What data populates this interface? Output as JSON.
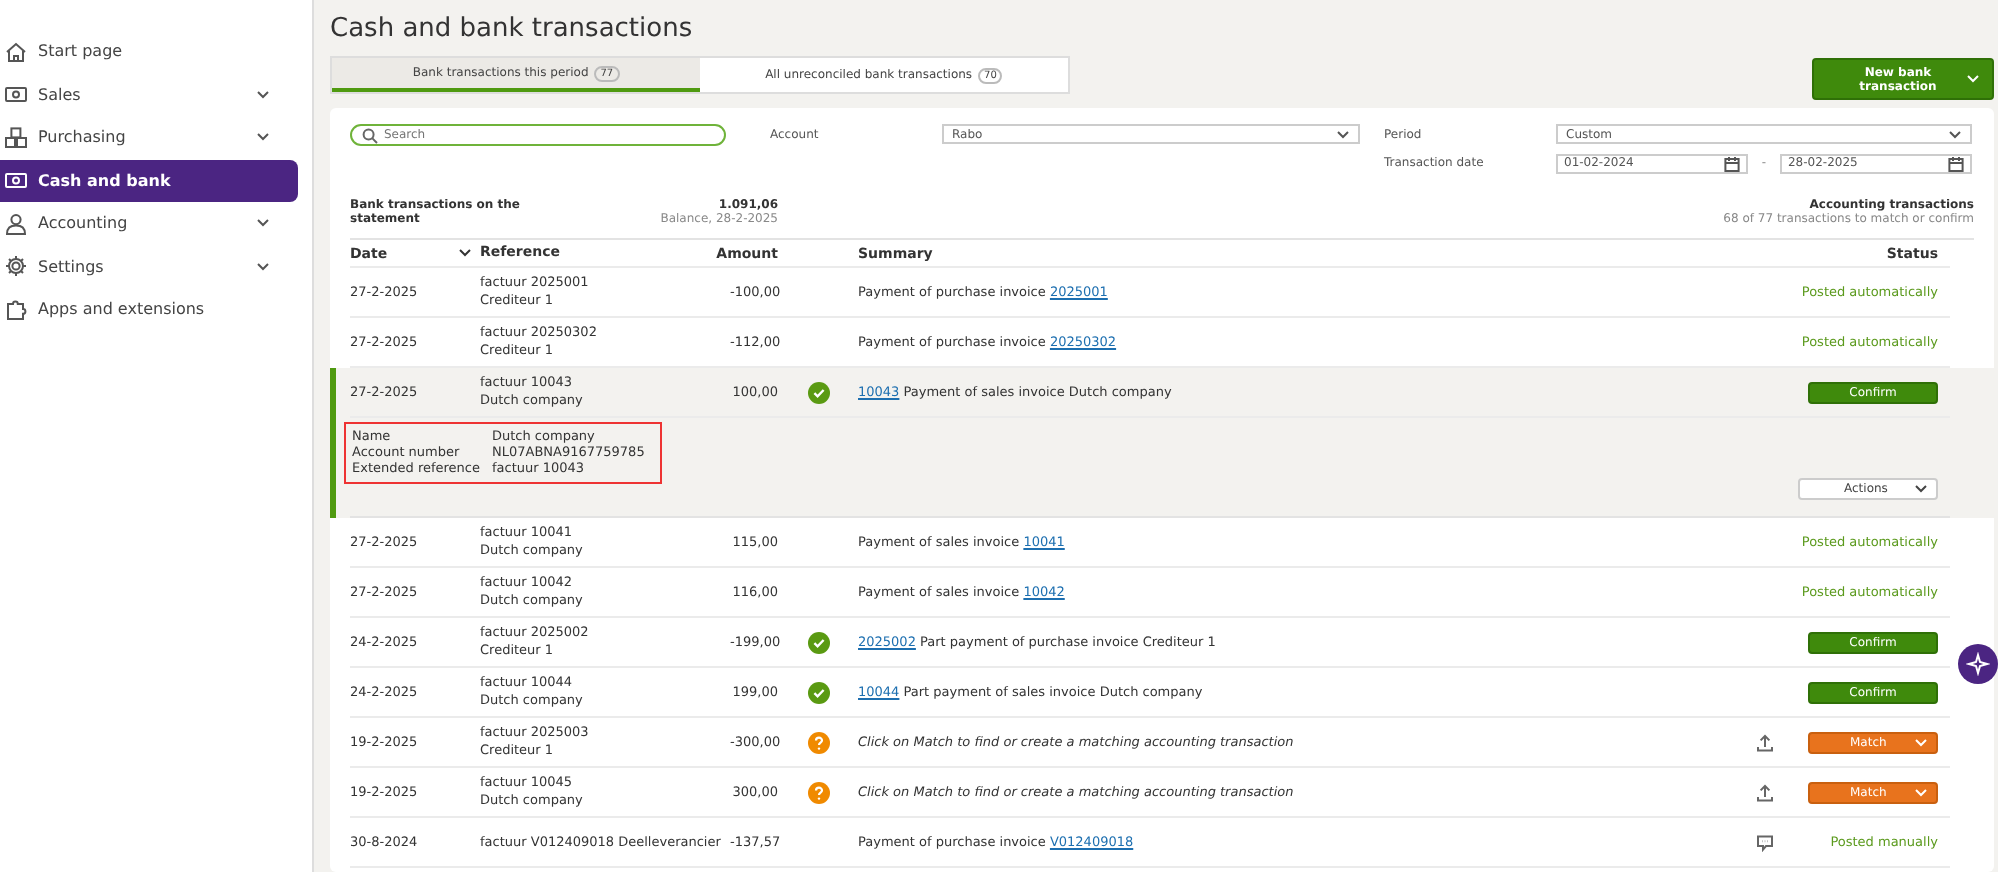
{
  "sidebar": {
    "items": [
      {
        "label": "Start page",
        "chevron": false,
        "selected": false
      },
      {
        "label": "Sales",
        "chevron": true,
        "selected": false
      },
      {
        "label": "Purchasing",
        "chevron": true,
        "selected": false
      },
      {
        "label": "Cash and bank",
        "chevron": false,
        "selected": true
      },
      {
        "label": "Accounting",
        "chevron": true,
        "selected": false
      },
      {
        "label": "Settings",
        "chevron": true,
        "selected": false
      },
      {
        "label": "Apps and extensions",
        "chevron": false,
        "selected": false
      }
    ]
  },
  "page": {
    "title": "Cash and bank transactions"
  },
  "tabs": [
    {
      "label": "Bank transactions this period",
      "count": "77",
      "selected": true
    },
    {
      "label": "All unreconciled bank transactions",
      "count": "70",
      "selected": false
    }
  ],
  "new_button": {
    "label": "New bank transaction"
  },
  "filters": {
    "search": {
      "placeholder": "Search"
    },
    "account": {
      "label": "Account",
      "value": "Rabo"
    },
    "period": {
      "label": "Period",
      "value": "Custom"
    },
    "transaction_date": {
      "label": "Transaction date",
      "from": "01-02-2024",
      "separator": "-",
      "to": "28-02-2025"
    }
  },
  "statement": {
    "label": "Bank transactions on the statement",
    "amount": "1.091,06",
    "balance": "Balance, 28-2-2025"
  },
  "accounting": {
    "label": "Accounting transactions",
    "note": "68 of 77 transactions to match or confirm"
  },
  "table": {
    "columns": [
      "Date",
      "Reference",
      "Amount",
      "Summary",
      "Status"
    ],
    "rows": [
      {
        "kind": "posted",
        "date": "27-2-2025",
        "reference": [
          "factuur 2025001",
          "Crediteur 1"
        ],
        "amount": "-100,00",
        "summary": {
          "kind": "link_last",
          "text": "Payment of purchase invoice",
          "link": "2025001"
        },
        "has_note": false,
        "status": "Posted automatically",
        "expanded": false
      },
      {
        "kind": "posted",
        "date": "27-2-2025",
        "reference": [
          "factuur 20250302",
          "Crediteur 1"
        ],
        "amount": "-112,00",
        "summary": {
          "kind": "link_last",
          "text": "Payment of purchase invoice",
          "link": "20250302"
        },
        "has_note": false,
        "status": "Posted automatically",
        "expanded": false
      },
      {
        "kind": "confirm",
        "date": "27-2-2025",
        "reference": [
          "factuur 10043",
          "Dutch company"
        ],
        "amount": "100,00",
        "summary": {
          "kind": "link_first",
          "text": "Payment of sales invoice Dutch company",
          "link": "10043"
        },
        "has_note": false,
        "status": "Confirm",
        "expanded": true,
        "details": [
          {
            "label": "Name",
            "value": "Dutch company"
          },
          {
            "label": "Account number",
            "value": "NL07ABNA9167759785"
          },
          {
            "label": "Extended reference",
            "value": "factuur 10043"
          }
        ],
        "actions_label": "Actions"
      },
      {
        "kind": "posted",
        "date": "27-2-2025",
        "reference": [
          "factuur 10041",
          "Dutch company"
        ],
        "amount": "115,00",
        "summary": {
          "kind": "link_last",
          "text": "Payment of sales invoice",
          "link": "10041"
        },
        "has_note": false,
        "status": "Posted automatically",
        "expanded": false
      },
      {
        "kind": "posted",
        "date": "27-2-2025",
        "reference": [
          "factuur 10042",
          "Dutch company"
        ],
        "amount": "116,00",
        "summary": {
          "kind": "link_last",
          "text": "Payment of sales invoice",
          "link": "10042"
        },
        "has_note": false,
        "status": "Posted automatically",
        "expanded": false
      },
      {
        "kind": "confirm",
        "date": "24-2-2025",
        "reference": [
          "factuur 2025002",
          "Crediteur 1"
        ],
        "amount": "-199,00",
        "summary": {
          "kind": "link_first",
          "text": "Part payment of purchase invoice Crediteur 1",
          "link": "2025002"
        },
        "has_note": false,
        "status": "Confirm",
        "expanded": false
      },
      {
        "kind": "confirm",
        "date": "24-2-2025",
        "reference": [
          "factuur 10044",
          "Dutch company"
        ],
        "amount": "199,00",
        "summary": {
          "kind": "link_first",
          "text": "Part payment of sales invoice Dutch company",
          "link": "10044"
        },
        "has_note": false,
        "status": "Confirm",
        "expanded": false
      },
      {
        "kind": "match",
        "date": "19-2-2025",
        "reference": [
          "factuur 2025003",
          "Crediteur 1"
        ],
        "amount": "-300,00",
        "summary": {
          "kind": "hint",
          "text": "Click on Match to find or create a matching accounting transaction"
        },
        "has_note": false,
        "status": "Match",
        "expanded": false
      },
      {
        "kind": "match",
        "date": "19-2-2025",
        "reference": [
          "factuur 10045",
          "Dutch company"
        ],
        "amount": "300,00",
        "summary": {
          "kind": "hint",
          "text": "Click on Match to find or create a matching accounting transaction"
        },
        "has_note": false,
        "status": "Match",
        "expanded": false
      },
      {
        "kind": "posted",
        "date": "30-8-2024",
        "reference": [
          "factuur V012409018 Deelleverancier"
        ],
        "amount": "-137,57",
        "summary": {
          "kind": "link_last",
          "text": "Payment of purchase invoice",
          "link": "V012409018"
        },
        "has_note": true,
        "status": "Posted manually",
        "expanded": false
      }
    ]
  }
}
